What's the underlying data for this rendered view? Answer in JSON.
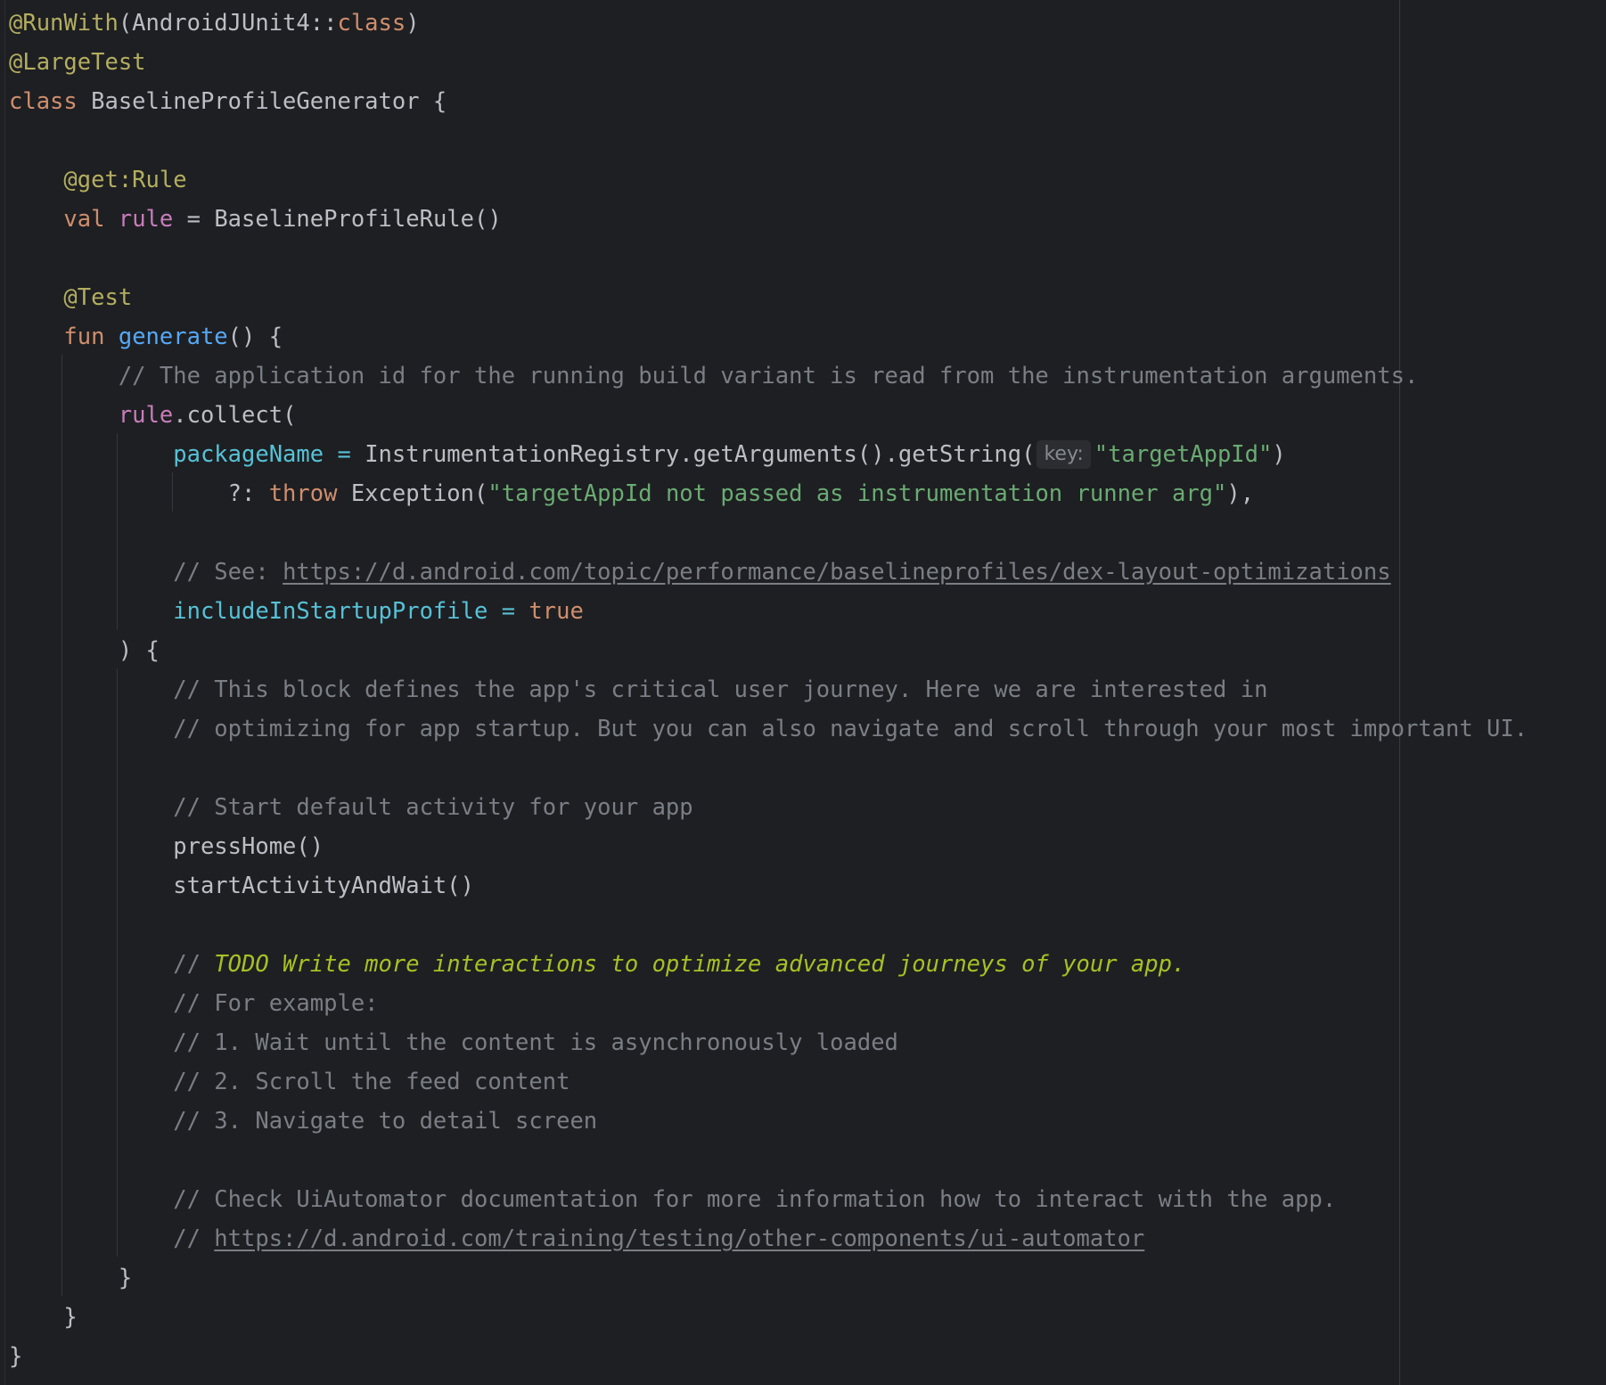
{
  "editor": {
    "language": "Kotlin",
    "colors": {
      "background": "#1e1f22",
      "annotation": "#b3ae60",
      "keyword": "#cf8e6d",
      "property": "#c77dbb",
      "function": "#56a8f5",
      "comment": "#7a7e85",
      "string": "#6aab73",
      "named_argument": "#56c1d6",
      "todo": "#a8c023",
      "default_text": "#bcbec4"
    },
    "lines": [
      {
        "tokens": [
          {
            "t": "@RunWith",
            "s": "ann"
          },
          {
            "t": "(AndroidJUnit4::",
            "s": "cls"
          },
          {
            "t": "class",
            "s": "kw"
          },
          {
            "t": ")",
            "s": "cls"
          }
        ]
      },
      {
        "tokens": [
          {
            "t": "@LargeTest",
            "s": "ann"
          }
        ]
      },
      {
        "tokens": [
          {
            "t": "class ",
            "s": "kw"
          },
          {
            "t": "BaselineProfileGenerator {",
            "s": "cls"
          }
        ]
      },
      {
        "tokens": []
      },
      {
        "tokens": [
          {
            "t": "    ",
            "s": "cls"
          },
          {
            "t": "@get:Rule",
            "s": "ann"
          }
        ]
      },
      {
        "tokens": [
          {
            "t": "    ",
            "s": "cls"
          },
          {
            "t": "val ",
            "s": "kw"
          },
          {
            "t": "rule",
            "s": "prop"
          },
          {
            "t": " = BaselineProfileRule()",
            "s": "cls"
          }
        ]
      },
      {
        "tokens": []
      },
      {
        "tokens": [
          {
            "t": "    ",
            "s": "cls"
          },
          {
            "t": "@Test",
            "s": "ann"
          }
        ]
      },
      {
        "tokens": [
          {
            "t": "    ",
            "s": "cls"
          },
          {
            "t": "fun ",
            "s": "kw"
          },
          {
            "t": "generate",
            "s": "fn"
          },
          {
            "t": "() {",
            "s": "cls"
          }
        ]
      },
      {
        "tokens": [
          {
            "t": "        ",
            "s": "cls"
          },
          {
            "t": "// The application id for the running build variant is read from the instrumentation arguments.",
            "s": "com"
          }
        ]
      },
      {
        "tokens": [
          {
            "t": "        ",
            "s": "cls"
          },
          {
            "t": "rule",
            "s": "prop"
          },
          {
            "t": ".collect(",
            "s": "cls"
          }
        ]
      },
      {
        "tokens": [
          {
            "t": "            ",
            "s": "cls"
          },
          {
            "t": "packageName",
            "s": "named"
          },
          {
            "t": " = ",
            "s": "named"
          },
          {
            "t": "InstrumentationRegistry.getArguments().getString(",
            "s": "cls"
          },
          {
            "t": "key:",
            "s": "hint"
          },
          {
            "t": "\"targetAppId\"",
            "s": "str"
          },
          {
            "t": ")",
            "s": "cls"
          }
        ]
      },
      {
        "tokens": [
          {
            "t": "                ",
            "s": "cls"
          },
          {
            "t": "?: ",
            "s": "cls"
          },
          {
            "t": "throw ",
            "s": "kw"
          },
          {
            "t": "Exception(",
            "s": "cls"
          },
          {
            "t": "\"targetAppId not passed as instrumentation runner arg\"",
            "s": "str"
          },
          {
            "t": "),",
            "s": "cls"
          }
        ]
      },
      {
        "tokens": []
      },
      {
        "tokens": [
          {
            "t": "            ",
            "s": "cls"
          },
          {
            "t": "// See: ",
            "s": "com"
          },
          {
            "t": "https://d.android.com/topic/performance/baselineprofiles/dex-layout-optimizations",
            "s": "link"
          }
        ]
      },
      {
        "tokens": [
          {
            "t": "            ",
            "s": "cls"
          },
          {
            "t": "includeInStartupProfile",
            "s": "named"
          },
          {
            "t": " = ",
            "s": "named"
          },
          {
            "t": "true",
            "s": "kw"
          }
        ]
      },
      {
        "tokens": [
          {
            "t": "        ",
            "s": "cls"
          },
          {
            "t": ") {",
            "s": "cls"
          }
        ]
      },
      {
        "tokens": [
          {
            "t": "            ",
            "s": "cls"
          },
          {
            "t": "// This block defines the app's critical user journey. Here we are interested in",
            "s": "com"
          }
        ]
      },
      {
        "tokens": [
          {
            "t": "            ",
            "s": "cls"
          },
          {
            "t": "// optimizing for app startup. But you can also navigate and scroll through your most important UI.",
            "s": "com"
          }
        ]
      },
      {
        "tokens": []
      },
      {
        "tokens": [
          {
            "t": "            ",
            "s": "cls"
          },
          {
            "t": "// Start default activity for your app",
            "s": "com"
          }
        ]
      },
      {
        "tokens": [
          {
            "t": "            ",
            "s": "cls"
          },
          {
            "t": "pressHome()",
            "s": "cls"
          }
        ]
      },
      {
        "tokens": [
          {
            "t": "            ",
            "s": "cls"
          },
          {
            "t": "startActivityAndWait()",
            "s": "cls"
          }
        ]
      },
      {
        "tokens": []
      },
      {
        "tokens": [
          {
            "t": "            ",
            "s": "cls"
          },
          {
            "t": "// ",
            "s": "com"
          },
          {
            "t": "TODO Write more interactions to optimize advanced journeys of your app.",
            "s": "todo"
          }
        ]
      },
      {
        "tokens": [
          {
            "t": "            ",
            "s": "cls"
          },
          {
            "t": "// For example:",
            "s": "com"
          }
        ]
      },
      {
        "tokens": [
          {
            "t": "            ",
            "s": "cls"
          },
          {
            "t": "// 1. Wait until the content is asynchronously loaded",
            "s": "com"
          }
        ]
      },
      {
        "tokens": [
          {
            "t": "            ",
            "s": "cls"
          },
          {
            "t": "// 2. Scroll the feed content",
            "s": "com"
          }
        ]
      },
      {
        "tokens": [
          {
            "t": "            ",
            "s": "cls"
          },
          {
            "t": "// 3. Navigate to detail screen",
            "s": "com"
          }
        ]
      },
      {
        "tokens": []
      },
      {
        "tokens": [
          {
            "t": "            ",
            "s": "cls"
          },
          {
            "t": "// Check UiAutomator documentation for more information how to interact with the app.",
            "s": "com"
          }
        ]
      },
      {
        "tokens": [
          {
            "t": "            ",
            "s": "cls"
          },
          {
            "t": "// ",
            "s": "com"
          },
          {
            "t": "https://d.android.com/training/testing/other-components/ui-automator",
            "s": "link"
          }
        ]
      },
      {
        "tokens": [
          {
            "t": "        ",
            "s": "cls"
          },
          {
            "t": "}",
            "s": "cls"
          }
        ]
      },
      {
        "tokens": [
          {
            "t": "    ",
            "s": "cls"
          },
          {
            "t": "}",
            "s": "cls"
          }
        ]
      },
      {
        "tokens": [
          {
            "t": "}",
            "s": "cls"
          }
        ]
      }
    ]
  }
}
